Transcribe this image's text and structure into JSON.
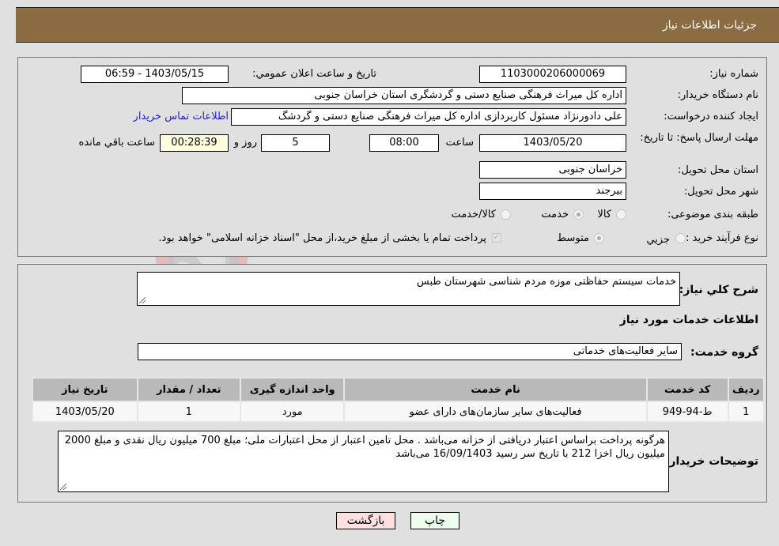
{
  "header": {
    "title": "جزئیات اطلاعات نیاز"
  },
  "form": {
    "need_number": {
      "label": "شماره نیاز:",
      "value": "1103000206000069"
    },
    "announce_datetime": {
      "label": "تاریخ و ساعت اعلان عمومي:",
      "value": "1403/05/15 - 06:59"
    },
    "buyer_org": {
      "label": "نام دستگاه خریدار:",
      "value": "اداره کل میراث فرهنگی  صنایع دستی و گردشگری استان خراسان جنوبی"
    },
    "requester": {
      "label": "ایجاد کننده درخواست:",
      "value": "علی دادورنژاد مسئول کاربردازی اداره کل میراث فرهنگی  صنایع دستی و گردشگ"
    },
    "buyer_contact_link": "اطلاعات تماس خریدار",
    "deadline": {
      "label": "مهلت ارسال پاسخ: تا تاریخ:",
      "date": "1403/05/20",
      "time_label": "ساعت",
      "time": "08:00",
      "days": "5",
      "days_label": "روز و",
      "remaining": "00:28:39",
      "remaining_label": "ساعت باقي مانده"
    },
    "province": {
      "label": "استان محل تحویل:",
      "value": "خراسان جنوبی"
    },
    "city": {
      "label": "شهر محل تحویل:",
      "value": "بیرجند"
    },
    "category": {
      "label": "طبقه بندی موضوعی:",
      "options": [
        "کالا",
        "خدمت",
        "کالا/خدمت"
      ],
      "selected": "خدمت"
    },
    "purchase_type": {
      "label": "نوع فرآیند خرید :",
      "options": [
        "جزیي",
        "متوسط"
      ],
      "selected": "متوسط",
      "treasury_checkbox_label": "پرداخت تمام یا بخشی از مبلغ خرید،از محل \"اسناد خزانه اسلامی\" خواهد بود.",
      "treasury_checked": true
    }
  },
  "details": {
    "summary_label": "شرح کلي نیاز:",
    "summary_value": "خدمات سیستم حفاظتی موزه مردم شناسی شهرستان طبس",
    "services_heading": "اطلاعات خدمات مورد نیاز",
    "service_group_label": "گروه خدمت:",
    "service_group_value": "سایر فعالیت‌های خدماتی",
    "table": {
      "headers": [
        "ردیف",
        "کد خدمت",
        "نام خدمت",
        "واحد اندازه گیری",
        "تعداد / مقدار",
        "تاریخ نیاز"
      ],
      "rows": [
        [
          "1",
          "ط-94-949",
          "فعالیت‌های سایر سازمان‌های دارای عضو",
          "مورد",
          "1",
          "1403/05/20"
        ]
      ]
    },
    "buyer_notes_label": "توضیحات خریدار:",
    "buyer_notes_value": "هرگونه پرداخت براساس اعتبار دریافتی از خزانه می‌باشد . محل تامین اعتبار از محل اعتبارات ملی؛ مبلغ 700 میلیون ریال نقدی و مبلغ 2000 میلیون ریال اخزا 212  با تاریخ سر رسید 16/09/1403 می‌باشد"
  },
  "buttons": {
    "print": "چاپ",
    "back": "بازگشت"
  },
  "watermark": {
    "text": "AriaTender.neT"
  },
  "colors": {
    "header_bg": "#8b6b42",
    "link": "#2222cc",
    "print_bg": "#eeffee",
    "back_bg": "#ffe0e0",
    "remaining_bg": "#ffffe0"
  }
}
